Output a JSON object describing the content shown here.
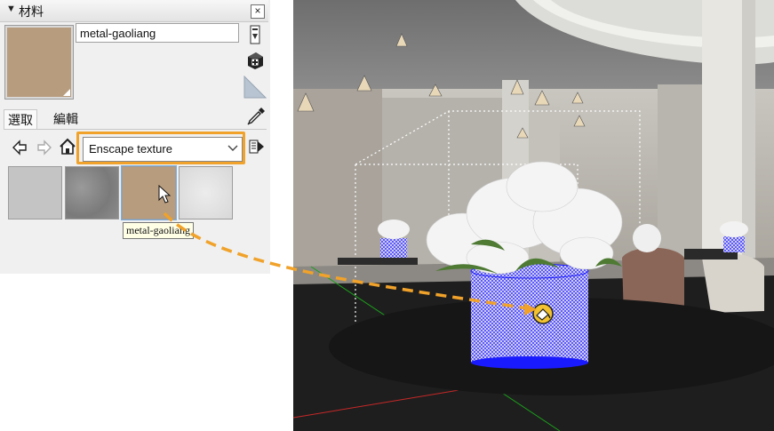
{
  "panel": {
    "title": "材料",
    "collapse_glyph": "▼",
    "close_glyph": "×",
    "material_name": "metal-gaoliang",
    "swatch_color": "#b89c7e",
    "tabs": [
      {
        "label": "選取",
        "active": true
      },
      {
        "label": "編輯",
        "active": false
      }
    ],
    "library_dropdown": "Enscape texture",
    "textures": [
      {
        "name": "texture-light-gray",
        "color": "#c2c2c2"
      },
      {
        "name": "texture-dark-gray",
        "color": "#8d8d8d"
      },
      {
        "name": "texture-metal-gaoliang",
        "color": "#b89c7e"
      },
      {
        "name": "texture-white-stucco",
        "color": "#e4e4e4"
      }
    ],
    "tooltip": "metal-gaoliang",
    "icons": {
      "collapse": "triangle-down-icon",
      "close": "close-icon",
      "details": "details-arrow-icon",
      "create": "create-material-icon",
      "default": "default-material-icon",
      "eyedropper": "eyedropper-icon",
      "back": "back-arrow-icon",
      "forward": "forward-arrow-icon",
      "home": "home-icon",
      "details_menu": "details-menu-icon"
    }
  },
  "colors": {
    "highlight": "#f0a22a",
    "panel_bg": "#f0f0f0",
    "mesh": "#1a1aff"
  },
  "viewport": {
    "description_icons": [
      "paint-bucket-cursor-icon",
      "pointer-cursor-icon"
    ]
  }
}
